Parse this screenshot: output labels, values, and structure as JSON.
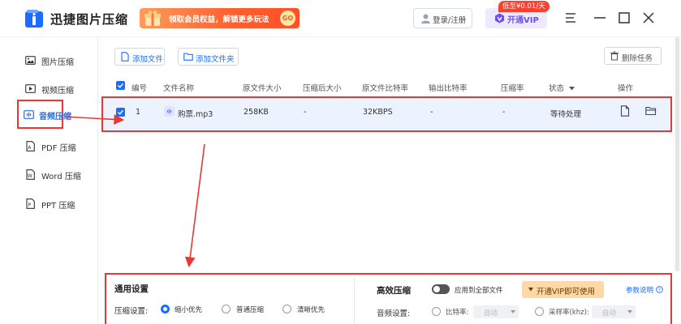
{
  "app": {
    "title": "迅捷图片压缩",
    "promo_text": "领取会员权益，解锁更多玩法",
    "promo_go": "GO",
    "login_label": "登录/注册",
    "vip_label": "开通VIP",
    "vip_tag": "低至¥0.01/天"
  },
  "sidebar": {
    "items": [
      {
        "label": "图片压缩",
        "icon": "image-icon"
      },
      {
        "label": "视频压缩",
        "icon": "video-icon"
      },
      {
        "label": "音频压缩",
        "icon": "audio-icon",
        "active": true
      },
      {
        "label": "PDF 压缩",
        "icon": "pdf-icon"
      },
      {
        "label": "Word 压缩",
        "icon": "word-icon"
      },
      {
        "label": "PPT 压缩",
        "icon": "ppt-icon"
      }
    ]
  },
  "toolbar": {
    "add_file": "添加文件",
    "add_folder": "添加文件夹",
    "delete_task": "删除任务"
  },
  "table": {
    "headers": {
      "index": "编号",
      "name": "文件名称",
      "orig_size": "原文件大小",
      "compressed_size": "压缩后大小",
      "orig_bitrate": "原文件比特率",
      "out_bitrate": "输出比特率",
      "ratio": "压缩率",
      "status": "状态",
      "action": "操作"
    },
    "rows": [
      {
        "index": "1",
        "name": "购票.mp3",
        "orig_size": "258KB",
        "compressed_size": "-",
        "orig_bitrate": "32KBPS",
        "out_bitrate": "-",
        "ratio": "-",
        "status": "等待处理"
      }
    ]
  },
  "settings": {
    "general_title": "通用设置",
    "compress_label": "压缩设置:",
    "options": [
      "缩小优先",
      "普通压缩",
      "清晰优先"
    ],
    "selected_option": "缩小优先",
    "efficient_title": "高效压缩",
    "apply_all": "应用到全部文件",
    "vip_open": "开通VIP即可使用",
    "param_help": "参数说明",
    "audio_label": "音频设置:",
    "bitrate_label": "比特率:",
    "bitrate_value": "自动",
    "samplerate_label": "采样率(khz):",
    "samplerate_value": "自动"
  },
  "colors": {
    "accent": "#1a6dff",
    "annotation": "#e53935",
    "promo": "#ff5e2e",
    "vip": "#6c4ff2"
  }
}
